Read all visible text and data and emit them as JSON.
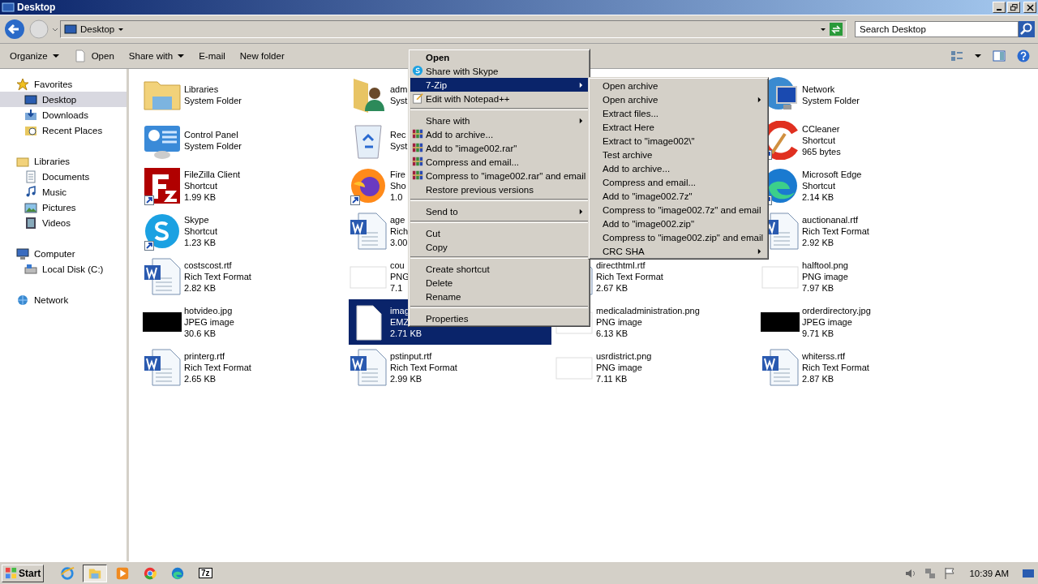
{
  "window": {
    "title": "Desktop"
  },
  "address": {
    "location": "Desktop"
  },
  "search": {
    "placeholder": "Search Desktop"
  },
  "toolbar": [
    {
      "label": "Organize",
      "kind": "menu"
    },
    {
      "label": "Open",
      "kind": "file"
    },
    {
      "label": "Share with",
      "kind": "menu"
    },
    {
      "label": "E-mail",
      "kind": "plain"
    },
    {
      "label": "New folder",
      "kind": "plain"
    }
  ],
  "sidebar": [
    {
      "label": "Favorites",
      "children": [
        {
          "label": "Desktop",
          "selected": true
        },
        {
          "label": "Downloads",
          "selected": false
        },
        {
          "label": "Recent Places",
          "selected": false
        }
      ]
    },
    {
      "label": "Libraries",
      "children": [
        {
          "label": "Documents",
          "selected": false
        },
        {
          "label": "Music",
          "selected": false
        },
        {
          "label": "Pictures",
          "selected": false
        },
        {
          "label": "Videos",
          "selected": false
        }
      ]
    },
    {
      "label": "Computer",
      "children": [
        {
          "label": "Local Disk (C:)",
          "selected": false
        }
      ]
    },
    {
      "label": "Network"
    }
  ],
  "file_columns": [
    [
      {
        "kind": "library",
        "lines": [
          "Libraries",
          "System Folder"
        ],
        "shortcut": false,
        "selected": false
      },
      {
        "kind": "control-panel",
        "lines": [
          "Control Panel",
          "System Folder"
        ],
        "shortcut": false,
        "selected": false
      },
      {
        "kind": "filezilla",
        "lines": [
          "FileZilla Client",
          "Shortcut",
          "1.99 KB"
        ],
        "shortcut": true,
        "selected": false
      },
      {
        "kind": "skype",
        "lines": [
          "Skype",
          "Shortcut",
          "1.23 KB"
        ],
        "shortcut": true,
        "selected": false
      },
      {
        "kind": "word",
        "lines": [
          "costscost.rtf",
          "Rich Text Format",
          "2.82 KB"
        ],
        "shortcut": false,
        "selected": false
      },
      {
        "kind": "thumbnail",
        "lines": [
          "hotvideo.jpg",
          "JPEG image",
          "30.6 KB"
        ],
        "shortcut": false,
        "selected": false
      },
      {
        "kind": "word",
        "lines": [
          "printerg.rtf",
          "Rich Text Format",
          "2.65 KB"
        ],
        "shortcut": false,
        "selected": false
      }
    ],
    [
      {
        "kind": "user-folder",
        "lines": [
          "adm",
          "Syst"
        ],
        "shortcut": false,
        "selected": false
      },
      {
        "kind": "recycle-bin",
        "lines": [
          "Rec",
          "Syst"
        ],
        "shortcut": false,
        "selected": false
      },
      {
        "kind": "firefox",
        "lines": [
          "Fire",
          "Sho",
          "1.0"
        ],
        "shortcut": true,
        "selected": false
      },
      {
        "kind": "word",
        "lines": [
          "age",
          "Rich",
          "3.00"
        ],
        "shortcut": false,
        "selected": false
      },
      {
        "kind": "preview",
        "lines": [
          "cou",
          "PNG",
          "7.1"
        ],
        "shortcut": false,
        "selected": false
      },
      {
        "kind": "blank-file",
        "lines": [
          "imag",
          "EMZ",
          "2.71 KB"
        ],
        "shortcut": false,
        "selected": true
      },
      {
        "kind": "word",
        "lines": [
          "pstinput.rtf",
          "Rich Text Format",
          "2.99 KB"
        ],
        "shortcut": false,
        "selected": false
      }
    ],
    [
      {
        "kind": "word",
        "lines": [
          "directhtml.rtf",
          "Rich Text Format",
          "2.67 KB"
        ],
        "selected": false
      },
      {
        "kind": "preview",
        "lines": [
          "medicaladministration.png",
          "PNG image",
          "6.13 KB"
        ],
        "selected": false
      },
      {
        "kind": "preview",
        "lines": [
          "usrdistrict.png",
          "PNG image",
          "7.11 KB"
        ],
        "selected": false
      }
    ],
    [
      {
        "kind": "network",
        "lines": [
          "Network",
          "System Folder"
        ],
        "shortcut": false,
        "selected": false
      },
      {
        "kind": "ccleaner",
        "lines": [
          "CCleaner",
          "Shortcut",
          "965 bytes"
        ],
        "shortcut": true,
        "selected": false
      },
      {
        "kind": "edge",
        "lines": [
          "Microsoft Edge",
          "Shortcut",
          "2.14 KB"
        ],
        "shortcut": true,
        "selected": false
      },
      {
        "kind": "word",
        "lines": [
          "auctionanal.rtf",
          "Rich Text Format",
          "2.92 KB"
        ],
        "shortcut": false,
        "selected": false
      },
      {
        "kind": "preview",
        "lines": [
          "halftool.png",
          "PNG image",
          "7.97 KB"
        ],
        "shortcut": false,
        "selected": false
      },
      {
        "kind": "thumbnail",
        "lines": [
          "orderdirectory.jpg",
          "JPEG image",
          "9.71 KB"
        ],
        "shortcut": false,
        "selected": false
      },
      {
        "kind": "word",
        "lines": [
          "whiterss.rtf",
          "Rich Text Format",
          "2.87 KB"
        ],
        "shortcut": false,
        "selected": false
      }
    ]
  ],
  "context_menu": [
    {
      "kind": "plain",
      "label": "Open",
      "default": true,
      "submenu": false,
      "selected": false
    },
    {
      "kind": "skype",
      "label": "Share with Skype",
      "default": false,
      "submenu": false,
      "selected": false
    },
    {
      "kind": "plain",
      "label": "7-Zip",
      "default": false,
      "submenu": true,
      "selected": true
    },
    {
      "kind": "notepad",
      "label": "Edit with Notepad++",
      "default": false,
      "submenu": false,
      "selected": false
    },
    {
      "kind": "separator"
    },
    {
      "kind": "plain",
      "label": "Share with",
      "default": false,
      "submenu": true,
      "selected": false
    },
    {
      "kind": "archive",
      "label": "Add to archive...",
      "default": false,
      "submenu": false,
      "selected": false
    },
    {
      "kind": "archive",
      "label": "Add to \"image002.rar\"",
      "default": false,
      "submenu": false,
      "selected": false
    },
    {
      "kind": "archive",
      "label": "Compress and email...",
      "default": false,
      "submenu": false,
      "selected": false
    },
    {
      "kind": "archive",
      "label": "Compress to \"image002.rar\" and email",
      "default": false,
      "submenu": false,
      "selected": false
    },
    {
      "kind": "plain",
      "label": "Restore previous versions",
      "default": false,
      "submenu": false,
      "selected": false
    },
    {
      "kind": "separator"
    },
    {
      "kind": "plain",
      "label": "Send to",
      "default": false,
      "submenu": true,
      "selected": false
    },
    {
      "kind": "separator"
    },
    {
      "kind": "plain",
      "label": "Cut",
      "default": false,
      "submenu": false,
      "selected": false
    },
    {
      "kind": "plain",
      "label": "Copy",
      "default": false,
      "submenu": false,
      "selected": false
    },
    {
      "kind": "separator"
    },
    {
      "kind": "plain",
      "label": "Create shortcut",
      "default": false,
      "submenu": false,
      "selected": false
    },
    {
      "kind": "plain",
      "label": "Delete",
      "default": false,
      "submenu": false,
      "selected": false
    },
    {
      "kind": "plain",
      "label": "Rename",
      "default": false,
      "submenu": false,
      "selected": false
    },
    {
      "kind": "separator"
    },
    {
      "kind": "plain",
      "label": "Properties",
      "default": false,
      "submenu": false,
      "selected": false
    }
  ],
  "zip_submenu": [
    {
      "label": "Open archive",
      "submenu": false
    },
    {
      "label": "Open archive",
      "submenu": true
    },
    {
      "label": "Extract files...",
      "submenu": false
    },
    {
      "label": "Extract Here",
      "submenu": false
    },
    {
      "label": "Extract to \"image002\\\"",
      "submenu": false
    },
    {
      "label": "Test archive",
      "submenu": false
    },
    {
      "label": "Add to archive...",
      "submenu": false
    },
    {
      "label": "Compress and email...",
      "submenu": false
    },
    {
      "label": "Add to \"image002.7z\"",
      "submenu": false
    },
    {
      "label": "Compress to \"image002.7z\" and email",
      "submenu": false
    },
    {
      "label": "Add to \"image002.zip\"",
      "submenu": false
    },
    {
      "label": "Compress to \"image002.zip\" and email",
      "submenu": false
    },
    {
      "label": "CRC SHA",
      "submenu": true
    }
  ],
  "taskbar": {
    "start": "Start",
    "apps": [
      {
        "kind": "browser",
        "selected": false
      },
      {
        "kind": "explorer",
        "selected": true
      },
      {
        "kind": "media",
        "selected": false
      },
      {
        "kind": "chrome",
        "selected": false
      },
      {
        "kind": "edge",
        "selected": false
      },
      {
        "kind": "archiver",
        "selected": false,
        "label": "7z"
      }
    ],
    "clock": "10:39 AM"
  }
}
